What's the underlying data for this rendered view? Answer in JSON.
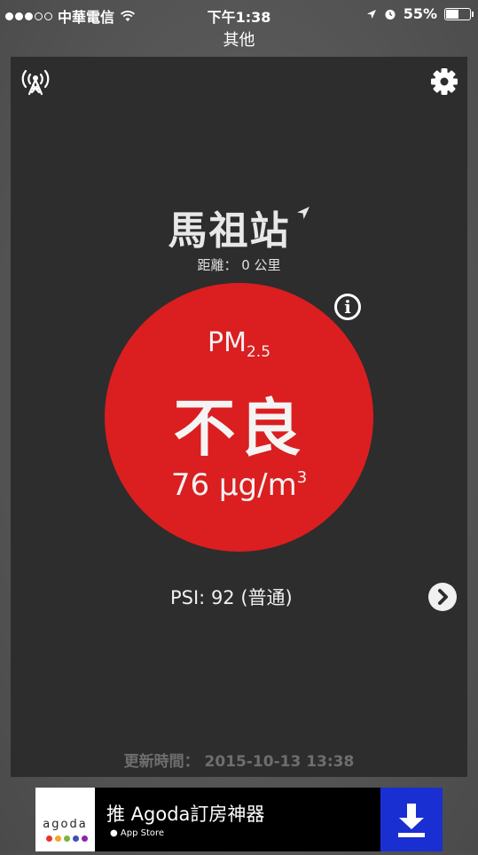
{
  "status_bar": {
    "carrier": "中華電信",
    "time": "下午1:38",
    "battery": "55%",
    "battery_level": 0.55
  },
  "nav": {
    "title": "其他"
  },
  "station": {
    "name": "馬祖站",
    "distance": "距離： 0 公里"
  },
  "reading": {
    "pollutant": "PM",
    "pollutant_sub": "2.5",
    "level": "不良",
    "value": "76 μg/m",
    "value_sup": "3",
    "circle_color": "#db1e1f"
  },
  "psi": {
    "text": "PSI: 92 (普通)"
  },
  "updated": {
    "text": "更新時間： 2015-10-13 13:38"
  },
  "ad": {
    "logo": "agoda",
    "title": "推 Agoda訂房神器",
    "store": "App Store",
    "download_color": "#1a2fd1"
  },
  "icons": {
    "antenna": "antenna-icon",
    "settings": "gear-icon",
    "info": "info-icon",
    "location": "location-arrow-icon",
    "next": "chevron-right-icon",
    "download": "download-icon"
  }
}
